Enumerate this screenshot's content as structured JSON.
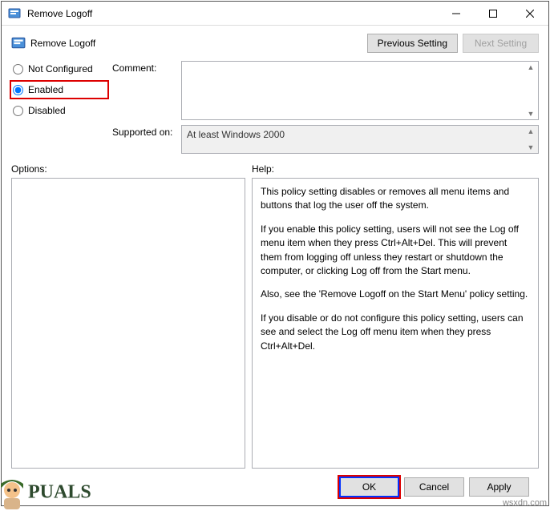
{
  "window": {
    "title": "Remove Logoff"
  },
  "header": {
    "title": "Remove Logoff",
    "previous_setting": "Previous Setting",
    "next_setting": "Next Setting"
  },
  "radio": {
    "not_configured": "Not Configured",
    "enabled": "Enabled",
    "disabled": "Disabled",
    "selected": "enabled"
  },
  "labels": {
    "comment": "Comment:",
    "supported_on": "Supported on:",
    "options": "Options:",
    "help": "Help:"
  },
  "fields": {
    "comment": "",
    "supported_on": "At least Windows 2000"
  },
  "help": {
    "p1": "This policy setting disables or removes all menu items and buttons that log the user off the system.",
    "p2": "If you enable this policy setting, users will not see the Log off menu item when they press Ctrl+Alt+Del. This will prevent them from logging off unless they restart or shutdown the computer, or clicking Log off from the Start menu.",
    "p3": "Also, see the 'Remove Logoff on the Start Menu' policy setting.",
    "p4": "If you disable or do not configure this policy setting, users can see and select the Log off menu item when they press Ctrl+Alt+Del."
  },
  "footer": {
    "ok": "OK",
    "cancel": "Cancel",
    "apply": "Apply"
  },
  "branding": {
    "text": "PUALS",
    "site": "wsxdn.com"
  }
}
